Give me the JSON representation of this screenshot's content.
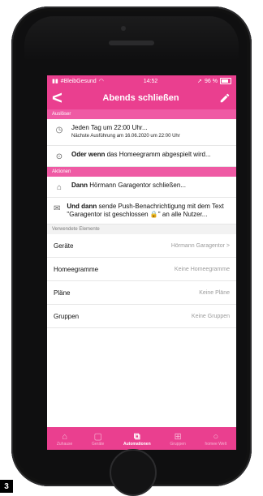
{
  "status": {
    "carrier": "#BleibGesund",
    "time": "14:52",
    "battery": "96 %"
  },
  "nav": {
    "back": "<",
    "title": "Abends schließen",
    "edit_icon": "pencil-icon"
  },
  "sections": {
    "trigger": "Auslöser",
    "actions": "Aktionen",
    "used": "Verwendete Elemente"
  },
  "trigger": {
    "schedule": "Jeden Tag um 22:00 Uhr...",
    "next": "Nächste Ausführung am 16.06.2020 um 22:00 Uhr",
    "or_prefix": "Oder wenn",
    "or_text": " das Homeegramm abgespielt wird..."
  },
  "actions": [
    {
      "prefix": "Dann",
      "text": " Hörmann Garagentor schließen..."
    },
    {
      "prefix": "Und dann",
      "text": " sende Push-Benachrichtigung mit dem Text \"Garagentor ist geschlossen 🔒\" an alle Nutzer..."
    }
  ],
  "elements": [
    {
      "label": "Geräte",
      "value": "Hörmann Garagentor  >"
    },
    {
      "label": "Homeegramme",
      "value": "Keine Homeegramme"
    },
    {
      "label": "Pläne",
      "value": "Keine Pläne"
    },
    {
      "label": "Gruppen",
      "value": "Keine Gruppen"
    }
  ],
  "tabs": [
    {
      "label": "Zuhause",
      "icon": "home-icon"
    },
    {
      "label": "Geräte",
      "icon": "device-icon"
    },
    {
      "label": "Automationen",
      "icon": "automation-icon",
      "active": true
    },
    {
      "label": "Gruppen",
      "icon": "groups-icon"
    },
    {
      "label": "homee Welt",
      "icon": "world-icon"
    }
  ],
  "figure_label": "3"
}
